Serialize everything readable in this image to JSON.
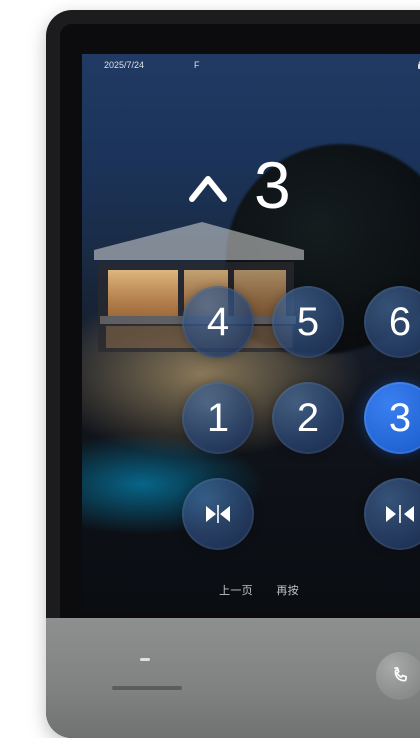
{
  "status_bar": {
    "time": "2025/7/24",
    "signal": "F",
    "right_icon": "lock-icon"
  },
  "floor_indicator": {
    "direction_icon": "up-arrow-icon",
    "floor": "3"
  },
  "keypad": {
    "buttons": [
      {
        "label": "4",
        "state": "normal"
      },
      {
        "label": "5",
        "state": "normal"
      },
      {
        "label": "6",
        "state": "normal"
      },
      {
        "label": "1",
        "state": "normal"
      },
      {
        "label": "2",
        "state": "normal"
      },
      {
        "label": "3",
        "state": "selected"
      }
    ],
    "door_open_icon": "door-open-icon",
    "door_close_icon": "door-close-icon"
  },
  "bottom_text": {
    "left": "上一页",
    "right": "再按"
  },
  "base": {
    "call_icon": "phone-icon"
  },
  "colors": {
    "accent": "#1758C8",
    "glass": "#22406E",
    "base": "#7F8281"
  }
}
